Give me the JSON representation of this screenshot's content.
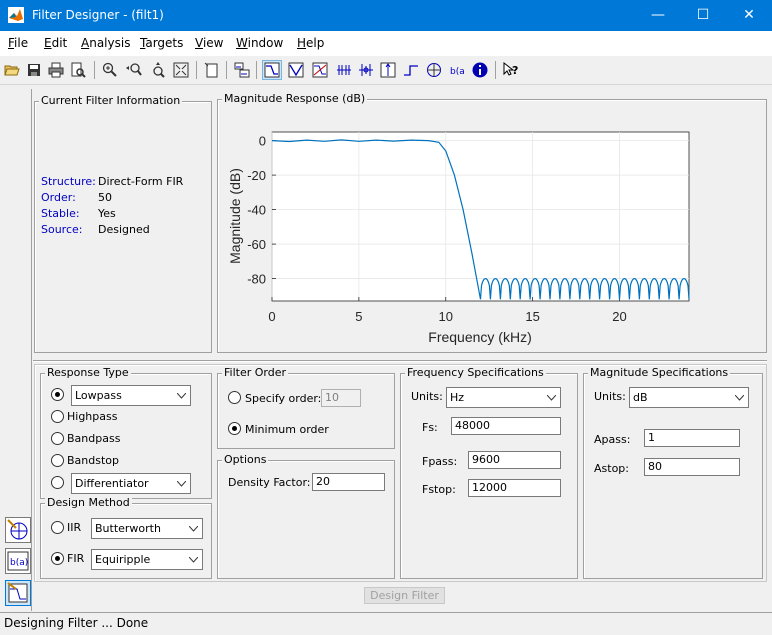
{
  "window": {
    "title": "Filter Designer -  (filt1)",
    "minimize": "—",
    "maximize": "☐",
    "close": "✕"
  },
  "menu": [
    {
      "label": "File",
      "u": "F",
      "rest": "ile"
    },
    {
      "label": "Edit",
      "u": "E",
      "rest": "dit"
    },
    {
      "label": "Analysis",
      "u": "A",
      "rest": "nalysis"
    },
    {
      "label": "Targets",
      "u": "T",
      "rest": "argets"
    },
    {
      "label": "View",
      "u": "V",
      "rest": "iew"
    },
    {
      "label": "Window",
      "u": "W",
      "rest": "indow"
    },
    {
      "label": "Help",
      "u": "H",
      "rest": "elp"
    }
  ],
  "current_filter": {
    "title": "Current Filter Information",
    "structure_label": "Structure:",
    "structure_value": "Direct-Form FIR",
    "order_label": "Order:",
    "order_value": "50",
    "stable_label": "Stable:",
    "stable_value": "Yes",
    "source_label": "Source:",
    "source_value": "Designed"
  },
  "plot_panel": {
    "title": "Magnitude Response (dB)"
  },
  "chart_data": {
    "type": "line",
    "title": "",
    "xlabel": "Frequency (kHz)",
    "ylabel": "Magnitude (dB)",
    "xlim": [
      0,
      24
    ],
    "ylim": [
      -93,
      5
    ],
    "xticks": [
      0,
      5,
      10,
      15,
      20
    ],
    "yticks": [
      0,
      -20,
      -40,
      -60,
      -80
    ],
    "grid": true,
    "line_color": "#0072bd",
    "series": [
      {
        "x": [
          0,
          1,
          2,
          3,
          4,
          5,
          6,
          7,
          8,
          9,
          9.6,
          10,
          10.5,
          11,
          11.5,
          12
        ],
        "y": [
          0,
          -0.5,
          0.3,
          -0.4,
          0.4,
          -0.4,
          0.3,
          -0.3,
          0.3,
          0,
          -1,
          -6,
          -20,
          -40,
          -65,
          -92
        ]
      }
    ],
    "stopband": {
      "start": 12.0,
      "end": 24,
      "lobes": 21,
      "peak": -80,
      "floor": -92
    }
  },
  "response_type": {
    "title": "Response Type",
    "options": [
      "Lowpass",
      "Highpass",
      "Bandpass",
      "Bandstop",
      "Differentiator"
    ],
    "selected": "Lowpass",
    "lowpass_select": "Lowpass",
    "other_select": "Differentiator"
  },
  "design_method": {
    "title": "Design Method",
    "iir_label": "IIR",
    "iir_select": "Butterworth",
    "fir_label": "FIR",
    "fir_select": "Equiripple",
    "selected": "FIR"
  },
  "filter_order": {
    "title": "Filter Order",
    "specify_label": "Specify order:",
    "specify_value": "10",
    "minimum_label": "Minimum order",
    "selected": "Minimum order"
  },
  "options": {
    "title": "Options",
    "density_label": "Density Factor:",
    "density_value": "20"
  },
  "freq_specs": {
    "title": "Frequency Specifications",
    "units_label": "Units:",
    "units_value": "Hz",
    "fs_label": "Fs:",
    "fs_value": "48000",
    "fpass_label": "Fpass:",
    "fpass_value": "9600",
    "fstop_label": "Fstop:",
    "fstop_value": "12000"
  },
  "mag_specs": {
    "title": "Magnitude Specifications",
    "units_label": "Units:",
    "units_value": "dB",
    "apass_label": "Apass:",
    "apass_value": "1",
    "astop_label": "Astop:",
    "astop_value": "80"
  },
  "design_button": "Design Filter",
  "status": "Designing Filter ... Done"
}
